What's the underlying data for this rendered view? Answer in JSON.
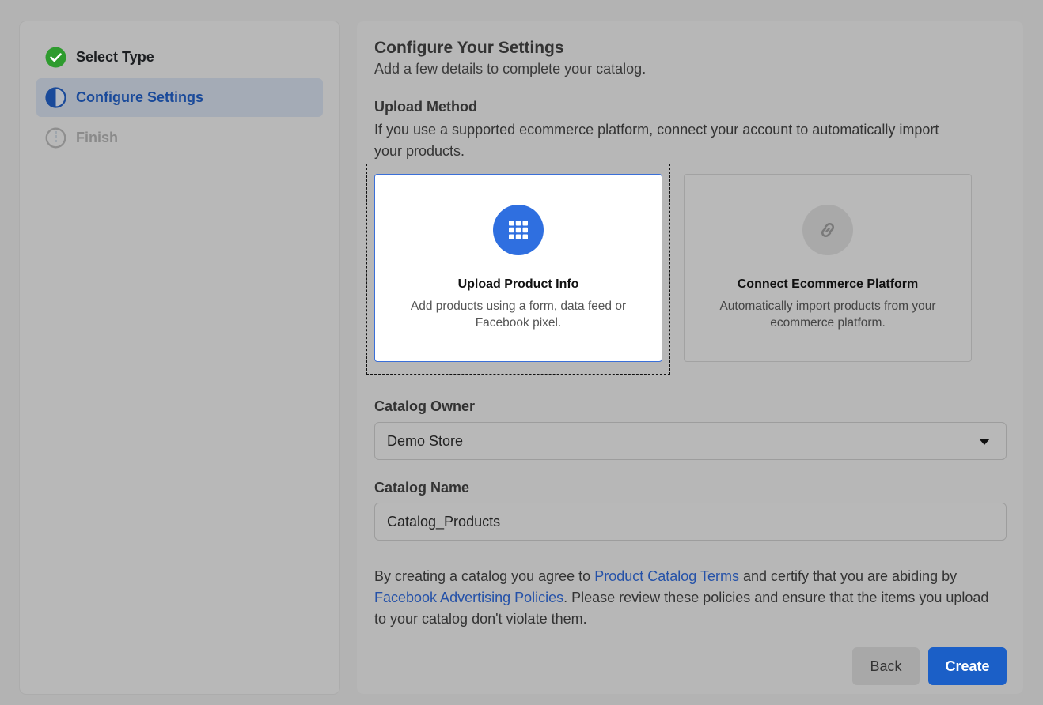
{
  "colors": {
    "accent": "#1b5fc7",
    "success": "#2e9b2e",
    "link": "#2451a8",
    "backdrop": "#b3b3b3"
  },
  "steps": [
    {
      "label": "Select Type",
      "status": "complete",
      "icon": "check-circle-icon"
    },
    {
      "label": "Configure Settings",
      "status": "in-progress",
      "icon": "half-circle-icon"
    },
    {
      "label": "Finish",
      "status": "pending",
      "icon": "empty-circle-icon"
    }
  ],
  "main": {
    "title": "Configure Your Settings",
    "subtitle": "Add a few details to complete your catalog.",
    "upload_method": {
      "heading": "Upload Method",
      "description": "If you use a supported ecommerce platform, connect your account to automatically import your products.",
      "options": [
        {
          "title": "Upload Product Info",
          "description": "Add products using a form, data feed or Facebook pixel.",
          "icon": "grid-icon",
          "selected": true
        },
        {
          "title": "Connect Ecommerce Platform",
          "description": "Automatically import products from your ecommerce platform.",
          "icon": "link-icon",
          "selected": false
        }
      ]
    },
    "catalog_owner": {
      "label": "Catalog Owner",
      "value": "Demo Store"
    },
    "catalog_name": {
      "label": "Catalog Name",
      "value": "Catalog_Products"
    },
    "terms": {
      "prefix": "By creating a catalog you agree to ",
      "link1": "Product Catalog Terms",
      "middle": " and certify that you are abiding by ",
      "link2": "Facebook Advertising Policies",
      "suffix": ". Please review these policies and ensure that the items you upload to your catalog don't violate them."
    },
    "buttons": {
      "back": "Back",
      "create": "Create"
    }
  }
}
